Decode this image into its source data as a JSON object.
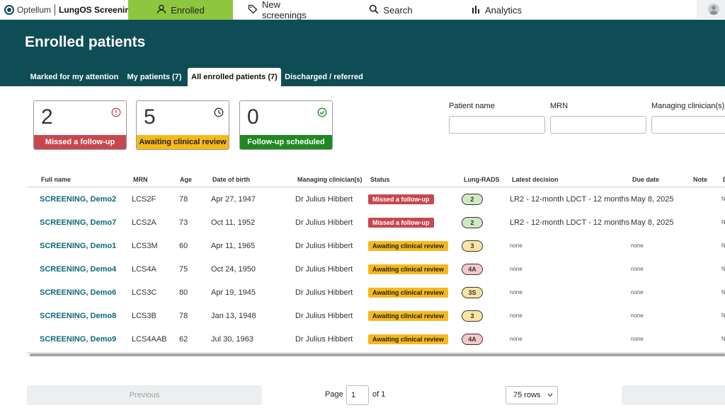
{
  "brand": {
    "name": "Optellum",
    "product": "LungOS Screening"
  },
  "nav": {
    "tabs": [
      {
        "label": "Enrolled",
        "icon": "user-icon"
      },
      {
        "label": "New screenings",
        "icon": "tag-icon"
      },
      {
        "label": "Search",
        "icon": "search-icon"
      },
      {
        "label": "Analytics",
        "icon": "bar-chart-icon"
      }
    ],
    "active_color": "#8dc63f"
  },
  "header": {
    "title": "Enrolled patients",
    "band_color": "#0f4d56",
    "tabs": [
      {
        "label": "Marked for my attention"
      },
      {
        "label": "My patients (7)"
      },
      {
        "label": "All enrolled patients (7)"
      },
      {
        "label": "Discharged / referred"
      }
    ]
  },
  "summary": [
    {
      "count": "2",
      "label": "Missed a follow-up",
      "color": "#c8474f",
      "icon": "alert-circle-icon"
    },
    {
      "count": "5",
      "label": "Awaiting clinical review",
      "color": "#f6b91b",
      "icon": "clock-icon"
    },
    {
      "count": "0",
      "label": "Follow-up scheduled",
      "color": "#1f8a22",
      "icon": "check-circle-icon"
    }
  ],
  "filters": {
    "patient_name": {
      "label": "Patient name",
      "value": ""
    },
    "mrn": {
      "label": "MRN",
      "value": ""
    },
    "clinician": {
      "label": "Managing clinician(s)",
      "value": ""
    }
  },
  "table": {
    "columns": [
      "Full name",
      "MRN",
      "Age",
      "Date of birth",
      "Managing clinician(s)",
      "Status",
      "Lung-RADS",
      "Latest decision",
      "Due date",
      "Note",
      "D"
    ],
    "rows": [
      {
        "name": "SCREENING, Demo2",
        "mrn": "LCS2F",
        "age": "78",
        "dob": "Apr 27, 1947",
        "clinician": "Dr Julius Hibbert",
        "status": "Missed a follow-up",
        "rads": "2",
        "decision": "LR2 - 12-month LDCT - 12 months",
        "due": "May 8, 2025",
        "note": "",
        "extra": "N"
      },
      {
        "name": "SCREENING, Demo7",
        "mrn": "LCS2A",
        "age": "73",
        "dob": "Oct 11, 1952",
        "clinician": "Dr Julius Hibbert",
        "status": "Missed a follow-up",
        "rads": "2",
        "decision": "LR2 - 12-month LDCT - 12 months",
        "due": "May 8, 2025",
        "note": "",
        "extra": "N"
      },
      {
        "name": "SCREENING, Demo1",
        "mrn": "LCS3M",
        "age": "60",
        "dob": "Apr 11, 1965",
        "clinician": "Dr Julius Hibbert",
        "status": "Awaiting clinical review",
        "rads": "3",
        "decision": "none",
        "due": "none",
        "note": "",
        "extra": "N"
      },
      {
        "name": "SCREENING, Demo4",
        "mrn": "LCS4A",
        "age": "75",
        "dob": "Oct 24, 1950",
        "clinician": "Dr Julius Hibbert",
        "status": "Awaiting clinical review",
        "rads": "4A",
        "decision": "none",
        "due": "none",
        "note": "",
        "extra": "N"
      },
      {
        "name": "SCREENING, Demo6",
        "mrn": "LCS3C",
        "age": "80",
        "dob": "Apr 19, 1945",
        "clinician": "Dr Julius Hibbert",
        "status": "Awaiting clinical review",
        "rads": "3S",
        "decision": "none",
        "due": "none",
        "note": "",
        "extra": "N"
      },
      {
        "name": "SCREENING, Demo8",
        "mrn": "LCS3B",
        "age": "78",
        "dob": "Jan 13, 1948",
        "clinician": "Dr Julius Hibbert",
        "status": "Awaiting clinical review",
        "rads": "3",
        "decision": "none",
        "due": "none",
        "note": "",
        "extra": "N"
      },
      {
        "name": "SCREENING, Demo9",
        "mrn": "LCS4AAB",
        "age": "62",
        "dob": "Jul 30, 1963",
        "clinician": "Dr Julius Hibbert",
        "status": "Awaiting clinical review",
        "rads": "4A",
        "decision": "none",
        "due": "none",
        "note": "",
        "extra": "N"
      }
    ]
  },
  "pagination": {
    "previous_label": "Previous",
    "page_label": "Page",
    "page_value": "1",
    "of_label": "of 1",
    "rows_label": "75 rows",
    "next_label": ""
  }
}
